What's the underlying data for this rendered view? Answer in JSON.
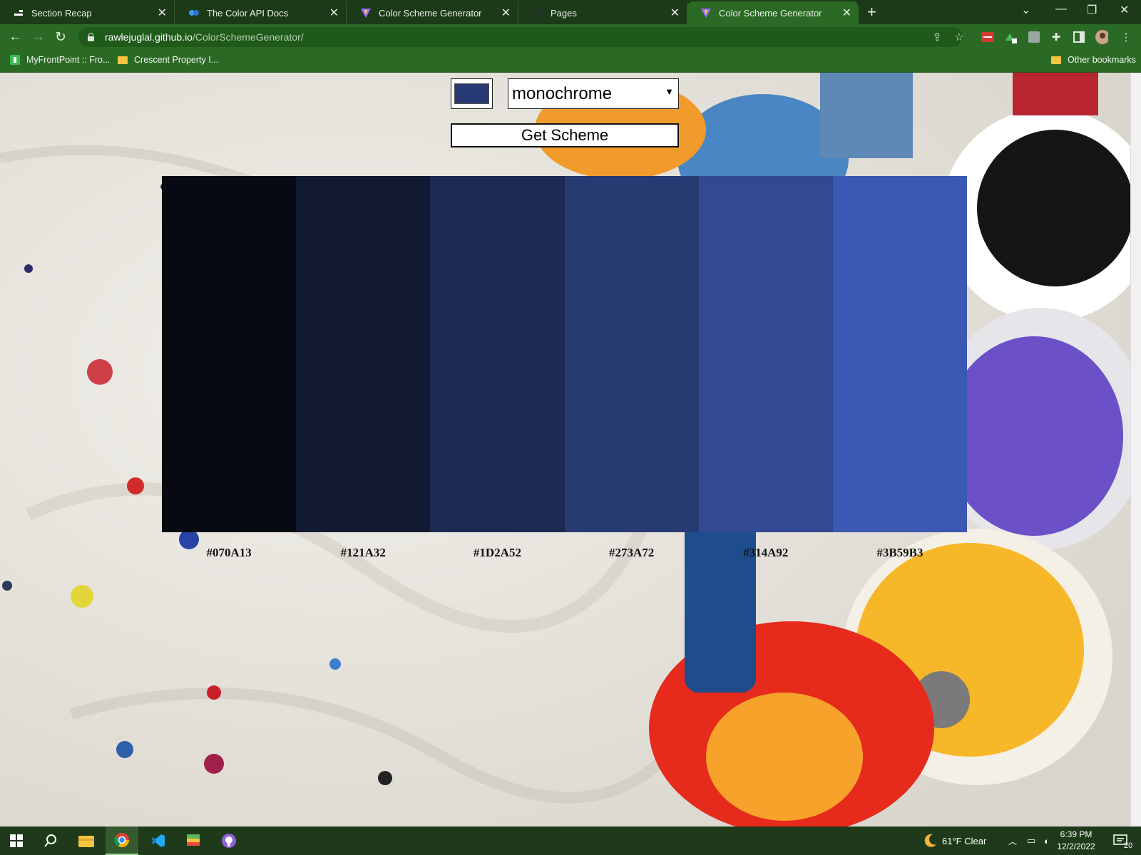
{
  "browser": {
    "tabs": [
      {
        "title": "Section Recap",
        "active": false
      },
      {
        "title": "The Color API Docs",
        "active": false
      },
      {
        "title": "Color Scheme Generator",
        "active": false
      },
      {
        "title": "Pages",
        "active": false
      },
      {
        "title": "Color Scheme Generator",
        "active": true
      }
    ],
    "url_host": "rawlejuglal.github.io",
    "url_path": "/ColorSchemeGenerator/",
    "bookmarks": [
      "MyFrontPoint :: Fro...",
      "Crescent Property I..."
    ],
    "other_bookmarks": "Other bookmarks"
  },
  "app": {
    "seed_color": "#283a74",
    "mode": "monochrome",
    "button_label": "Get Scheme",
    "colors": [
      {
        "hex": "#070A13"
      },
      {
        "hex": "#121A32"
      },
      {
        "hex": "#1D2A52"
      },
      {
        "hex": "#273A72"
      },
      {
        "hex": "#314A92"
      },
      {
        "hex": "#3B59B3"
      }
    ]
  },
  "taskbar": {
    "weather": "61°F  Clear",
    "time": "6:39 PM",
    "date": "12/2/2022",
    "notifications": "20"
  }
}
